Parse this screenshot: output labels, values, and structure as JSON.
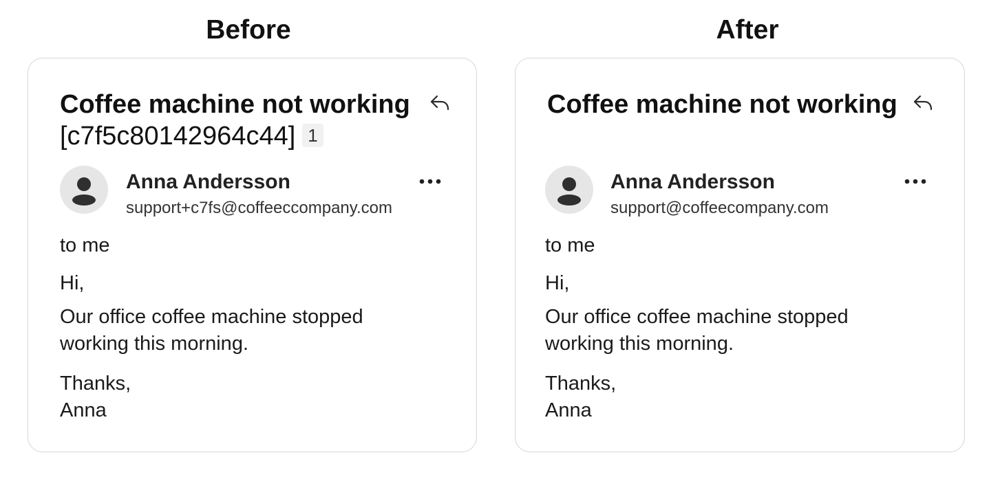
{
  "panels": [
    {
      "heading": "Before",
      "email": {
        "subject_title": "Coffee machine not working",
        "subject_tag": "[c7f5c80142964c44]",
        "message_count": "1",
        "sender_name": "Anna Andersson",
        "sender_email": "support+c7fs@coffeeccompany.com",
        "recipient": "to me",
        "greeting": "Hi,",
        "body_line_1": "Our office coffee machine stopped",
        "body_line_2": "working this morning.",
        "closing": "Thanks,",
        "signature": "Anna"
      }
    },
    {
      "heading": "After",
      "email": {
        "subject_title": "Coffee machine not working",
        "sender_name": "Anna Andersson",
        "sender_email": "support@coffeecompany.com",
        "recipient": "to me",
        "greeting": "Hi,",
        "body_line_1": "Our office coffee machine stopped",
        "body_line_2": "working this morning.",
        "closing": "Thanks,",
        "signature": "Anna"
      }
    }
  ],
  "icons": {
    "reply": "reply-arrow-icon",
    "more": "more-options-icon",
    "avatar": "person-avatar-icon"
  },
  "colors": {
    "card_border": "#d6d6d6",
    "avatar_bg": "#e6e6e6",
    "avatar_fg": "#2f2f2f",
    "badge_bg": "#f1f1f1"
  }
}
